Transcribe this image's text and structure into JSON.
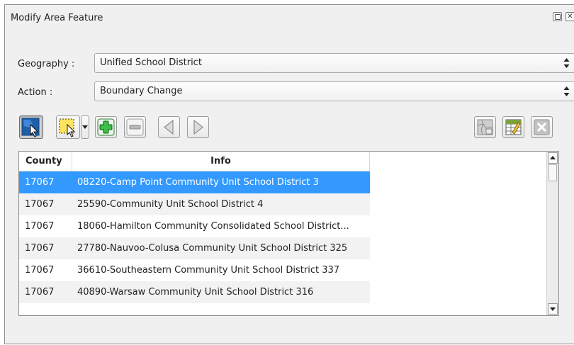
{
  "panel": {
    "title": "Modify Area Feature",
    "float_icon": "float-icon",
    "close_icon": "close-icon"
  },
  "geography": {
    "label": "Geography :",
    "value": "Unified School District"
  },
  "action": {
    "label": "Action :",
    "value": "Boundary Change"
  },
  "toolbar": {
    "left": [
      "select-feature-icon",
      "select-rectangle-icon",
      "dropdown-arrow-icon",
      "add-icon",
      "remove-icon",
      "previous-icon",
      "next-icon"
    ],
    "right": [
      "map-edit-icon",
      "table-edit-icon",
      "cancel-icon"
    ]
  },
  "table": {
    "headers": {
      "county": "County",
      "info": "Info"
    },
    "rows": [
      {
        "county": "17067",
        "info": "08220-Camp Point Community Unit School District 3",
        "selected": true
      },
      {
        "county": "17067",
        "info": "25590-Community Unit School District 4"
      },
      {
        "county": "17067",
        "info": "18060-Hamilton Community Consolidated School District..."
      },
      {
        "county": "17067",
        "info": "27780-Nauvoo-Colusa Community Unit School District 325"
      },
      {
        "county": "17067",
        "info": "36610-Southeastern Community Unit School District 337"
      },
      {
        "county": "17067",
        "info": "40890-Warsaw Community Unit School District 316"
      }
    ]
  },
  "colors": {
    "selection": "#3399ff",
    "panel": "#f0f0f0",
    "add_green": "#2fa23a"
  }
}
